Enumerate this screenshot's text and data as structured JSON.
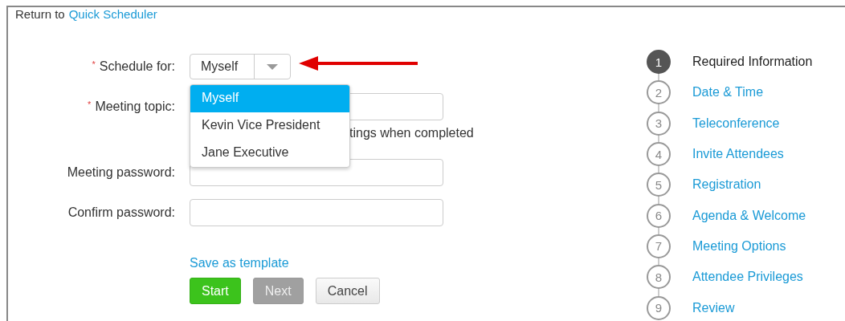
{
  "return_link": {
    "prefix": "Return to",
    "link": "Quick Scheduler"
  },
  "form": {
    "schedule_for": {
      "label": "Schedule for:",
      "required_mark": "*",
      "value": "Myself",
      "options": [
        {
          "label": "Myself",
          "selected": true
        },
        {
          "label": "Kevin Vice President",
          "selected": false
        },
        {
          "label": "Jane Executive",
          "selected": false
        }
      ]
    },
    "meeting_topic": {
      "label": "Meeting topic:",
      "required_mark": "*"
    },
    "covered_option_text": "tings when completed",
    "meeting_password": {
      "label": "Meeting password:"
    },
    "confirm_password": {
      "label": "Confirm password:"
    },
    "save_template_link": "Save as template",
    "buttons": [
      {
        "label": "Start",
        "kind": "primary",
        "disabled": false
      },
      {
        "label": "Next",
        "kind": "secondary",
        "disabled": true
      },
      {
        "label": "Cancel",
        "kind": "secondary",
        "disabled": false
      }
    ]
  },
  "steps": [
    {
      "number": "1",
      "label": "Required Information",
      "selected": true
    },
    {
      "number": "2",
      "label": "Date & Time",
      "selected": false
    },
    {
      "number": "3",
      "label": "Teleconference",
      "selected": false
    },
    {
      "number": "4",
      "label": "Invite Attendees",
      "selected": false
    },
    {
      "number": "5",
      "label": "Registration",
      "selected": false
    },
    {
      "number": "6",
      "label": "Agenda & Welcome",
      "selected": false
    },
    {
      "number": "7",
      "label": "Meeting Options",
      "selected": false
    },
    {
      "number": "8",
      "label": "Attendee Privileges",
      "selected": false
    },
    {
      "number": "9",
      "label": "Review",
      "selected": false
    }
  ]
}
